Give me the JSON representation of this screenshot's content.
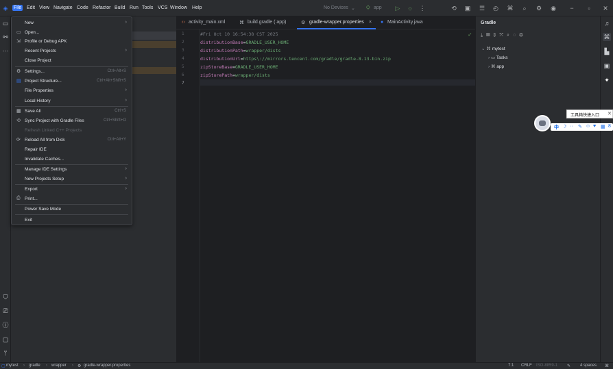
{
  "menubar": {
    "items": [
      "File",
      "Edit",
      "View",
      "Navigate",
      "Code",
      "Refactor",
      "Build",
      "Run",
      "Tools",
      "VCS",
      "Window",
      "Help"
    ],
    "device": "No Devices",
    "run_config": "app"
  },
  "file_menu": {
    "items": [
      {
        "label": "New",
        "arrow": true
      },
      {
        "label": "Open...",
        "icon": "folder-icon"
      },
      {
        "label": "Profile or Debug APK",
        "icon": "profile-icon"
      },
      {
        "label": "Recent Projects",
        "arrow": true
      },
      {
        "label": "Close Project"
      },
      {
        "label": "Settings...",
        "shortcut": "Ctrl+Alt+S",
        "icon": "gear-icon"
      },
      {
        "label": "Project Structure...",
        "shortcut": "Ctrl+Alt+Shift+S",
        "icon": "structure-icon"
      },
      {
        "label": "File Properties",
        "arrow": true
      },
      {
        "label": "Local History",
        "arrow": true
      },
      {
        "label": "Save All",
        "shortcut": "Ctrl+S",
        "icon": "save-icon"
      },
      {
        "label": "Sync Project with Gradle Files",
        "shortcut": "Ctrl+Shift+O",
        "icon": "sync-icon"
      },
      {
        "label": "Refresh Linked C++ Projects",
        "disabled": true
      },
      {
        "label": "Reload All from Disk",
        "shortcut": "Ctrl+Alt+Y",
        "icon": "reload-icon"
      },
      {
        "label": "Repair IDE"
      },
      {
        "label": "Invalidate Caches..."
      },
      {
        "label": "Manage IDE Settings",
        "arrow": true
      },
      {
        "label": "New Projects Setup",
        "arrow": true
      },
      {
        "label": "Export",
        "arrow": true
      },
      {
        "label": "Print...",
        "icon": "print-icon"
      },
      {
        "label": "Power Save Mode"
      },
      {
        "label": "Exit"
      }
    ]
  },
  "tabs": [
    {
      "label": "activity_main.xml"
    },
    {
      "label": "build.gradle (:app)"
    },
    {
      "label": "gradle-wrapper.properties",
      "active": true
    },
    {
      "label": "MainActivity.java"
    }
  ],
  "editor": {
    "line_numbers": [
      "1",
      "2",
      "3",
      "4",
      "5",
      "6",
      "7"
    ],
    "lines": [
      {
        "comment": "#Fri Oct 10 16:54:38 CST 2025"
      },
      {
        "key": "distributionBase",
        "value": "GRADLE_USER_HOME"
      },
      {
        "key": "distributionPath",
        "value": "wrapper/dists"
      },
      {
        "key": "distributionUrl",
        "value": "https\\://mirrors.tencent.com/gradle/gradle-8.13-bin.zip"
      },
      {
        "key": "zipStoreBase",
        "value": "GRADLE_USER_HOME"
      },
      {
        "key": "zipStorePath",
        "value": "wrapper/dists"
      }
    ]
  },
  "gradle_panel": {
    "title": "Gradle",
    "tree": [
      {
        "label": "mytest"
      },
      {
        "label": "Tasks"
      },
      {
        "label": "app"
      }
    ]
  },
  "floating": {
    "tooltip": "工具箱快捷入口",
    "tool_label": "中"
  },
  "statusbar": {
    "breadcrumbs": [
      "mytest",
      "gradle",
      "wrapper",
      "gradle-wrapper.properties"
    ],
    "position": "7:1",
    "line_sep": "CRLF",
    "encoding": "ISO-8859-1",
    "indent": "4 spaces"
  },
  "colors": {
    "accent": "#3574f0",
    "key": "#c77dbb",
    "value": "#6aab73"
  }
}
